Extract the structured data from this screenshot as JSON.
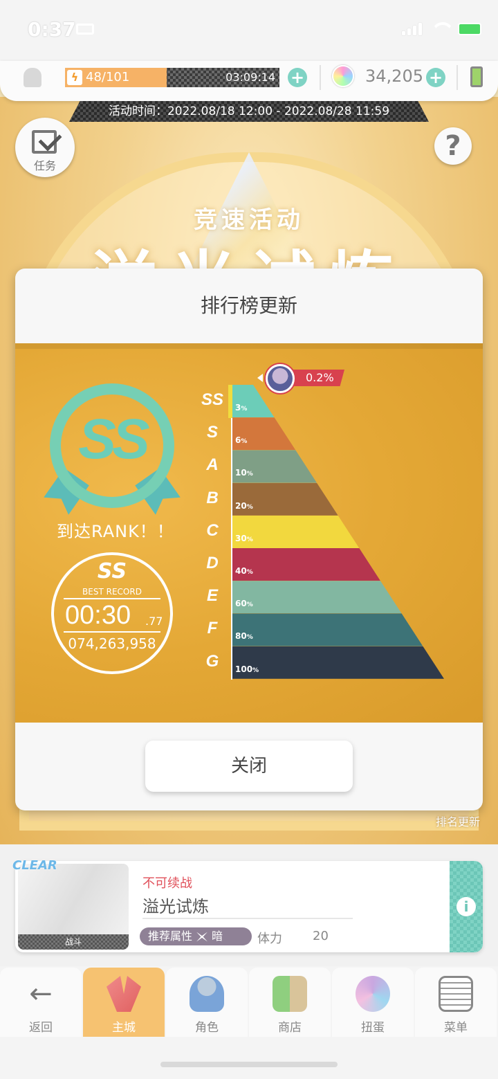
{
  "status_bar": {
    "time": "0:37"
  },
  "topbar": {
    "stamina": "48/101",
    "stamina_fraction": 0.475,
    "timer": "03:09:14",
    "gems": "34,205"
  },
  "event": {
    "time_label": "活动时间：2022.08/18 12:00 - 2022.08/28 11:59",
    "subtitle": "竞速活动",
    "title": "溢光试炼",
    "rank_update_label": "排名更新"
  },
  "task_button": {
    "label": "任务"
  },
  "help_button": {
    "label": "?"
  },
  "modal": {
    "title": "排行榜更新",
    "badge_rank": "SS",
    "reach_rank": "到达RANK！！",
    "record": {
      "rank": "SS",
      "label": "BEST RECORD",
      "time": "00:30",
      "ms": ".77",
      "score": "074,263,958"
    },
    "tiers": [
      {
        "letter": "SS",
        "pct": "3",
        "color": "#6ccdb8"
      },
      {
        "letter": "S",
        "pct": "6",
        "color": "#d3773c"
      },
      {
        "letter": "A",
        "pct": "10",
        "color": "#7f9f86"
      },
      {
        "letter": "B",
        "pct": "20",
        "color": "#9a6a3a"
      },
      {
        "letter": "C",
        "pct": "30",
        "color": "#f2d83e"
      },
      {
        "letter": "D",
        "pct": "40",
        "color": "#b5354e"
      },
      {
        "letter": "E",
        "pct": "60",
        "color": "#82b7a1"
      },
      {
        "letter": "F",
        "pct": "80",
        "color": "#3d7377"
      },
      {
        "letter": "G",
        "pct": "100",
        "color": "#2f3a4a"
      }
    ],
    "percent_sign": "%",
    "player_percent": "0.2%",
    "close_button": "关闭"
  },
  "stage": {
    "clear_tag": "CLEAR",
    "thumb_label": "战斗",
    "status": "不可续战",
    "name": "溢光试炼",
    "attr_label": "推荐属性",
    "attr_value": "暗",
    "stamina_label": "体力",
    "stamina_cost": "20"
  },
  "nav": [
    {
      "label": "返回",
      "icon": "back-arrow-icon"
    },
    {
      "label": "主城",
      "icon": "main-city-icon"
    },
    {
      "label": "角色",
      "icon": "character-icon"
    },
    {
      "label": "商店",
      "icon": "shop-icon"
    },
    {
      "label": "扭蛋",
      "icon": "gacha-icon"
    },
    {
      "label": "菜单",
      "icon": "menu-icon"
    }
  ]
}
